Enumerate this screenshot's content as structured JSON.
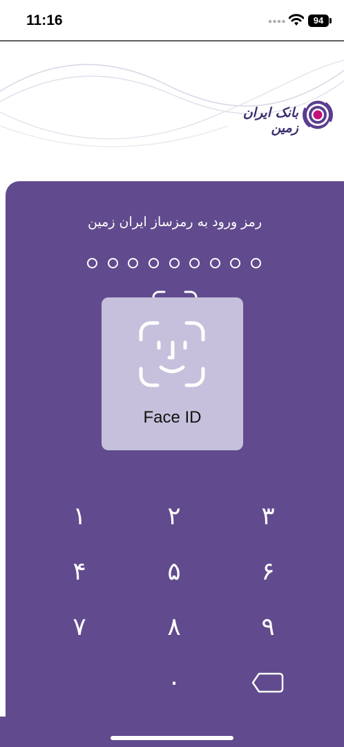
{
  "status_bar": {
    "time": "11:16",
    "battery": "94"
  },
  "header": {
    "bank_name": "بانک ایران زمین"
  },
  "login": {
    "prompt": "رمز ورود به رمزساز ایران زمین",
    "pin_length": 9
  },
  "keypad": {
    "keys": [
      "۱",
      "۲",
      "۳",
      "۴",
      "۵",
      "۶",
      "۷",
      "۸",
      "۹",
      "۰"
    ]
  },
  "faceid_overlay": {
    "label": "Face ID"
  },
  "colors": {
    "panel": "#614b8e",
    "overlay": "#c6c0dc",
    "logo_magenta": "#c2127a",
    "logo_purple": "#5a3d8f"
  }
}
